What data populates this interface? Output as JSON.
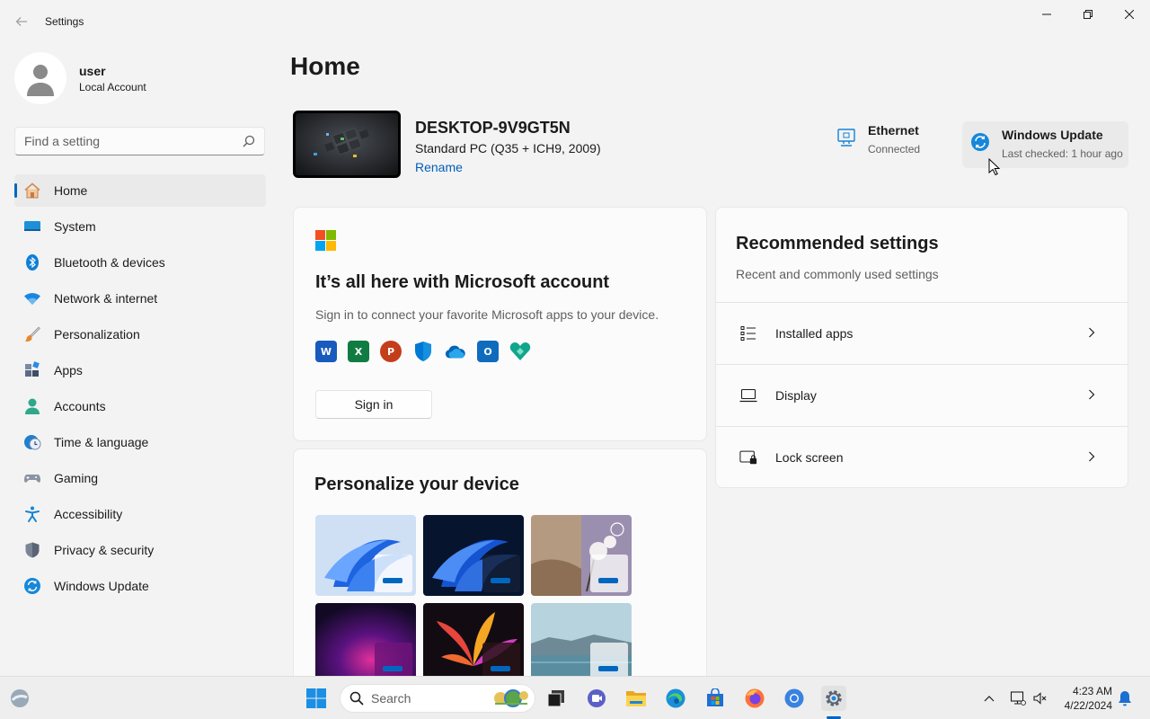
{
  "window": {
    "title": "Settings",
    "back_icon": "back-arrow-icon",
    "controls": [
      "minimize-icon",
      "maximize-icon",
      "close-icon"
    ]
  },
  "profile": {
    "name": "user",
    "account_type": "Local Account"
  },
  "search": {
    "placeholder": "Find a setting"
  },
  "sidebar": {
    "items": [
      {
        "label": "Home",
        "icon": "home-icon",
        "active": true
      },
      {
        "label": "System",
        "icon": "system-icon"
      },
      {
        "label": "Bluetooth & devices",
        "icon": "bluetooth-icon"
      },
      {
        "label": "Network & internet",
        "icon": "wifi-icon"
      },
      {
        "label": "Personalization",
        "icon": "brush-icon"
      },
      {
        "label": "Apps",
        "icon": "apps-icon"
      },
      {
        "label": "Accounts",
        "icon": "account-icon"
      },
      {
        "label": "Time & language",
        "icon": "clock-globe-icon"
      },
      {
        "label": "Gaming",
        "icon": "gamepad-icon"
      },
      {
        "label": "Accessibility",
        "icon": "accessibility-icon"
      },
      {
        "label": "Privacy & security",
        "icon": "shield-icon"
      },
      {
        "label": "Windows Update",
        "icon": "update-icon"
      }
    ]
  },
  "main": {
    "title": "Home",
    "device": {
      "name": "DESKTOP-9V9GT5N",
      "model": "Standard PC (Q35 + ICH9, 2009)",
      "rename_label": "Rename"
    },
    "status": {
      "ethernet": {
        "title": "Ethernet",
        "sub": "Connected"
      },
      "update": {
        "title": "Windows Update",
        "sub": "Last checked: 1 hour ago"
      }
    },
    "ms_account": {
      "title": "It’s all here with Microsoft account",
      "description": "Sign in to connect your favorite Microsoft apps to your device.",
      "apps": [
        {
          "name": "word-icon",
          "letter": "W",
          "color": "#185abd"
        },
        {
          "name": "excel-icon",
          "letter": "X",
          "color": "#107c41"
        },
        {
          "name": "powerpoint-icon",
          "letter": "P",
          "color": "#c43e1c"
        },
        {
          "name": "defender-icon",
          "letter": "",
          "color": "#0078d4"
        },
        {
          "name": "onedrive-icon",
          "letter": "",
          "color": "#0364b8"
        },
        {
          "name": "outlook-icon",
          "letter": "O",
          "color": "#0f6cbd"
        },
        {
          "name": "family-icon",
          "letter": "",
          "color": "#12a58d"
        }
      ],
      "sign_in_label": "Sign in"
    },
    "personalize": {
      "title": "Personalize your device",
      "themes": [
        {
          "name": "theme-windows-light",
          "bg": "#c9dcf3"
        },
        {
          "name": "theme-windows-dark",
          "bg": "#0a1a3a"
        },
        {
          "name": "theme-glow",
          "bg": "#a98d79"
        },
        {
          "name": "theme-captured-motion",
          "bg": "#3c0f4e"
        },
        {
          "name": "theme-flow",
          "bg": "#181018"
        },
        {
          "name": "theme-sunrise",
          "bg": "#8ab4c4"
        }
      ]
    },
    "recommended": {
      "title": "Recommended settings",
      "subtitle": "Recent and commonly used settings",
      "items": [
        {
          "label": "Installed apps",
          "icon": "list-icon"
        },
        {
          "label": "Display",
          "icon": "laptop-icon"
        },
        {
          "label": "Lock screen",
          "icon": "lock-screen-icon"
        }
      ]
    }
  },
  "taskbar": {
    "search_label": "Search",
    "apps": [
      "task-view-icon",
      "teams-icon",
      "file-explorer-icon",
      "edge-icon",
      "store-icon",
      "firefox-icon",
      "chrome-icon",
      "settings-icon"
    ],
    "active_app": "settings-icon",
    "time": "4:23 AM",
    "date": "4/22/2024"
  },
  "colors": {
    "accent": "#0067c0",
    "background": "#f3f3f3",
    "card": "#fbfbfb"
  }
}
